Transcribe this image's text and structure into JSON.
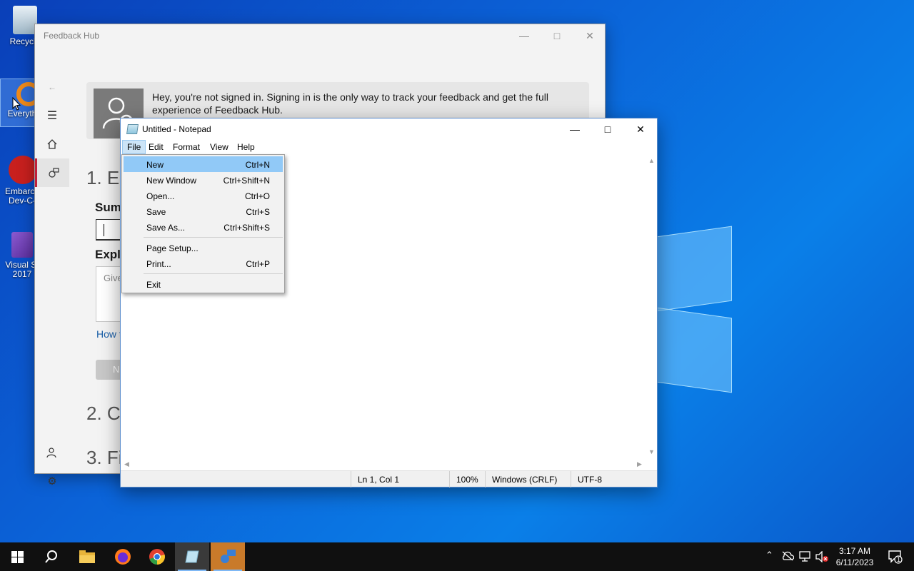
{
  "desktop": {
    "icons": [
      {
        "label": "Recycle"
      },
      {
        "label": "Everyth"
      },
      {
        "label": "Embarca Dev-C-"
      },
      {
        "label": "Visual St 2017"
      }
    ]
  },
  "feedback_hub": {
    "title": "Feedback Hub",
    "banner_text": "Hey, you're not signed in. Signing in is the only way to track your feedback and get the full experience of Feedback Hub.",
    "step1": "1. En",
    "summary_label": "Sum",
    "explain_label": "Expla",
    "explain_placeholder": "Give",
    "link_text": "How t",
    "next_button": "N",
    "step2": "2. C",
    "step3": "3. Fi"
  },
  "notepad": {
    "title": "Untitled - Notepad",
    "menus": [
      "File",
      "Edit",
      "Format",
      "View",
      "Help"
    ],
    "active_menu": "File",
    "content": "",
    "status": {
      "position": "Ln 1, Col 1",
      "zoom": "100%",
      "line_ending": "Windows (CRLF)",
      "encoding": "UTF-8"
    }
  },
  "file_menu": {
    "items": [
      {
        "label": "New",
        "shortcut": "Ctrl+N",
        "highlighted": true
      },
      {
        "label": "New Window",
        "shortcut": "Ctrl+Shift+N"
      },
      {
        "label": "Open...",
        "shortcut": "Ctrl+O"
      },
      {
        "label": "Save",
        "shortcut": "Ctrl+S"
      },
      {
        "label": "Save As...",
        "shortcut": "Ctrl+Shift+S"
      },
      {
        "label": "Page Setup...",
        "shortcut": ""
      },
      {
        "label": "Print...",
        "shortcut": "Ctrl+P"
      },
      {
        "label": "Exit",
        "shortcut": ""
      }
    ]
  },
  "taskbar": {
    "apps": [
      "start",
      "search",
      "file-explorer",
      "firefox",
      "chrome",
      "notepad",
      "feedback-hub"
    ],
    "clock_time": "3:17 AM",
    "clock_date": "6/11/2023",
    "notification_count": "1"
  },
  "colors": {
    "accent": "#0a63d8",
    "menu_highlight": "#91c9f7",
    "taskbar": "#101010"
  }
}
